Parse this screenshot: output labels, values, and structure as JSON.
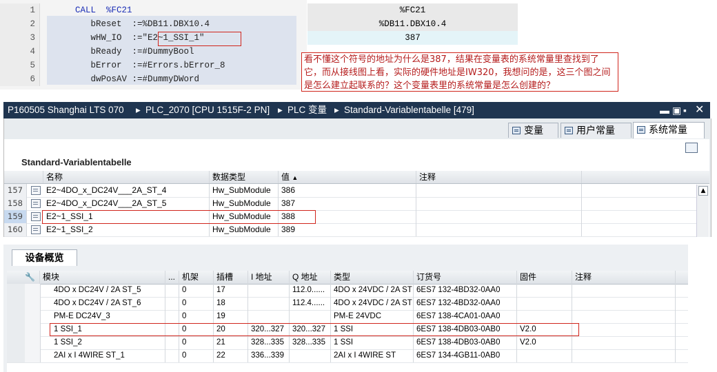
{
  "code": {
    "lines": [
      {
        "n": "1",
        "text": "      CALL  %FC21",
        "value": "%FC21"
      },
      {
        "n": "2",
        "text": "         bReset  :=%DB11.DBX10.4",
        "value": "%DB11.DBX10.4"
      },
      {
        "n": "3",
        "text": "         wHW_IO  :=\"E2~1_SSI_1\"",
        "value": "387"
      },
      {
        "n": "4",
        "text": "         bReady  :=#DummyBool",
        "value": ""
      },
      {
        "n": "5",
        "text": "         bError  :=#Errors.bError_8",
        "value": ""
      },
      {
        "n": "6",
        "text": "         dwPosAV :=#DummyDWord",
        "value": ""
      }
    ]
  },
  "callout": "看不懂这个符号的地址为什么是387，结果在变量表的系统常量里查找到了它，而从接线图上看，实际的硬件地址是IW320，我想问的是，这三个图之间是怎么建立起联系的？这个变量表里的系统常量是怎么创建的？",
  "window": {
    "breadcrumbs": [
      "P160505 Shanghai LTS 070",
      "PLC_2070 [CPU 1515F-2 PN]",
      "PLC 变量",
      "Standard-Variablentabelle [479]"
    ],
    "tabs": [
      {
        "label": "变量",
        "icon": "table-icon"
      },
      {
        "label": "用户常量",
        "icon": "constant-icon"
      },
      {
        "label": "系统常量",
        "icon": "system-constant-icon",
        "active": true
      }
    ],
    "table_title": "Standard-Variablentabelle",
    "columns": [
      "名称",
      "数据类型",
      "值",
      "注释"
    ],
    "rows": [
      {
        "num": "157",
        "name": "E2~4DO_x_DC24V___2A_ST_4",
        "type": "Hw_SubModule",
        "value": "386",
        "comment": ""
      },
      {
        "num": "158",
        "name": "E2~4DO_x_DC24V___2A_ST_5",
        "type": "Hw_SubModule",
        "value": "387",
        "comment": ""
      },
      {
        "num": "159",
        "name": "E2~1_SSI_1",
        "type": "Hw_SubModule",
        "value": "388",
        "comment": ""
      },
      {
        "num": "160",
        "name": "E2~1_SSI_2",
        "type": "Hw_SubModule",
        "value": "389",
        "comment": ""
      }
    ]
  },
  "device": {
    "tab": "设备概览",
    "columns": [
      "模块",
      "...",
      "机架",
      "插槽",
      "I 地址",
      "Q 地址",
      "类型",
      "订货号",
      "固件",
      "注释"
    ],
    "rows": [
      {
        "module": "4DO x DC24V / 2A ST_5",
        "rack": "0",
        "slot": "17",
        "i": "",
        "q": "112.0......",
        "type": "4DO x 24VDC / 2A ST",
        "order": "6ES7 132-4BD32-0AA0",
        "fw": ""
      },
      {
        "module": "4DO x DC24V / 2A ST_6",
        "rack": "0",
        "slot": "18",
        "i": "",
        "q": "112.4......",
        "type": "4DO x 24VDC / 2A ST",
        "order": "6ES7 132-4BD32-0AA0",
        "fw": ""
      },
      {
        "module": "PM-E DC24V_3",
        "rack": "0",
        "slot": "19",
        "i": "",
        "q": "",
        "type": "PM-E 24VDC",
        "order": "6ES7 138-4CA01-0AA0",
        "fw": ""
      },
      {
        "module": "1 SSI_1",
        "rack": "0",
        "slot": "20",
        "i": "320...327",
        "q": "320...327",
        "type": "1 SSI",
        "order": "6ES7 138-4DB03-0AB0",
        "fw": "V2.0"
      },
      {
        "module": "1 SSI_2",
        "rack": "0",
        "slot": "21",
        "i": "328...335",
        "q": "328...335",
        "type": "1 SSI",
        "order": "6ES7 138-4DB03-0AB0",
        "fw": "V2.0"
      },
      {
        "module": "2AI x I 4WIRE ST_1",
        "rack": "0",
        "slot": "22",
        "i": "336...339",
        "q": "",
        "type": "2AI x I 4WIRE ST",
        "order": "6ES7 134-4GB11-0AB0",
        "fw": ""
      }
    ]
  },
  "colors": {
    "title_bar": "#1f3550",
    "highlight_border": "#d0241b",
    "callout_text": "#b51c1c"
  }
}
